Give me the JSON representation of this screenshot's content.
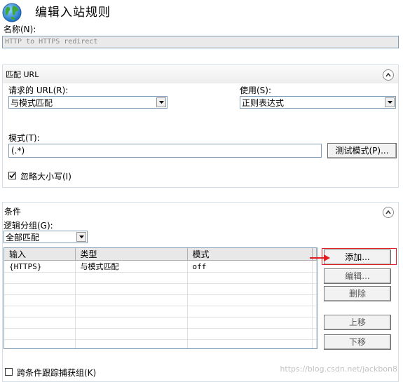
{
  "header": {
    "title": "编辑入站规则"
  },
  "name_field": {
    "label": "名称(N):",
    "value": "HTTP to HTTPS redirect"
  },
  "match_section": {
    "title": "匹配 URL",
    "requested_url_label": "请求的 URL(R):",
    "requested_url_value": "与模式匹配",
    "using_label": "使用(S):",
    "using_value": "正则表达式",
    "pattern_label": "模式(T):",
    "pattern_value": "(.*)",
    "test_button": "测试模式(P)...",
    "ignore_case_label": "忽略大小写(I)",
    "ignore_case_checked": true
  },
  "conditions_section": {
    "title": "条件",
    "logical_group_label": "逻辑分组(G):",
    "logical_group_value": "全部匹配",
    "columns": [
      "输入",
      "类型",
      "模式"
    ],
    "rows": [
      [
        "{HTTPS}",
        "与模式匹配",
        "off"
      ]
    ],
    "buttons": {
      "add": "添加...",
      "edit": "编辑...",
      "delete": "删除",
      "move_up": "上移",
      "move_down": "下移"
    },
    "track_groups_label": "跨条件跟踪捕获组(K)",
    "track_groups_checked": false
  },
  "watermark": "https://blog.csdn.net/jackbon8",
  "colors": {
    "highlight": "#e02020",
    "border": "#7f9db9"
  }
}
